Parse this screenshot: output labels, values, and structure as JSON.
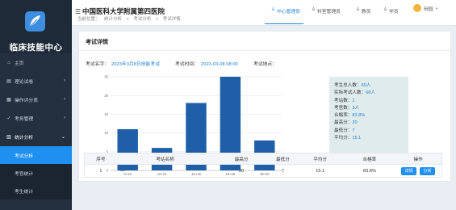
{
  "sidebar": {
    "brand": "临床技能中心",
    "items": [
      {
        "label": "主页",
        "icon": "home-icon"
      },
      {
        "label": "理论试卷",
        "icon": "document-icon"
      },
      {
        "label": "操作评分表",
        "icon": "clipboard-icon"
      },
      {
        "label": "考务管理",
        "icon": "check-icon"
      },
      {
        "label": "统计分析",
        "icon": "chart-icon"
      }
    ],
    "sub_items": [
      {
        "label": "考试分析",
        "active": true
      },
      {
        "label": "考官统计",
        "active": false
      },
      {
        "label": "考生统计",
        "active": false
      }
    ]
  },
  "header": {
    "hospital": "中国医科大学附属第四医院",
    "breadcrumb": [
      "当前位置：",
      "统计分析",
      ">",
      "考试分析",
      ">",
      "考试详情"
    ],
    "nav": [
      "中心管理员",
      "科室管理员",
      "教员",
      "学员"
    ],
    "user": "田园"
  },
  "panel": {
    "title": "考试详情",
    "exam_name_label": "考试名字：",
    "exam_name": "2023年3月8日技能考试",
    "exam_time_label": "考试时间：",
    "exam_time": "2023-03-08 08:00",
    "exam_place_label": "考试地点：",
    "exam_place": ""
  },
  "chart_data": {
    "type": "bar",
    "categories": [
      "0~12",
      "12~14",
      "14~16",
      "16~18",
      "18~20"
    ],
    "values": [
      11,
      6,
      18,
      25,
      8
    ],
    "ylim": [
      0,
      25
    ],
    "yticks": [
      "0",
      "5",
      "10",
      "15",
      "20",
      "25"
    ],
    "colors": {
      "bar": "#1f5fa8"
    },
    "grid": true
  },
  "stats": [
    {
      "label": "考生总人数：",
      "value": "69人"
    },
    {
      "label": "实际考试人数：",
      "value": "68人"
    },
    {
      "label": "考站数：",
      "value": "1"
    },
    {
      "label": "考官数：",
      "value": "3人"
    },
    {
      "label": "合格率：",
      "value": "83.8%"
    },
    {
      "label": "最高分：",
      "value": "20"
    },
    {
      "label": "最低分：",
      "value": "7"
    },
    {
      "label": "平均分：",
      "value": "15.1"
    }
  ],
  "table": {
    "headers": [
      "序号",
      "考站名称",
      "最高分",
      "最低分",
      "平均分",
      "合格率",
      "操作"
    ],
    "rows": [
      {
        "no": "1",
        "name": "—",
        "max": "20",
        "min": "7",
        "avg": "15.1",
        "rate": "83.8%"
      }
    ],
    "detail_label": "详情",
    "analysis_label": "分析"
  }
}
